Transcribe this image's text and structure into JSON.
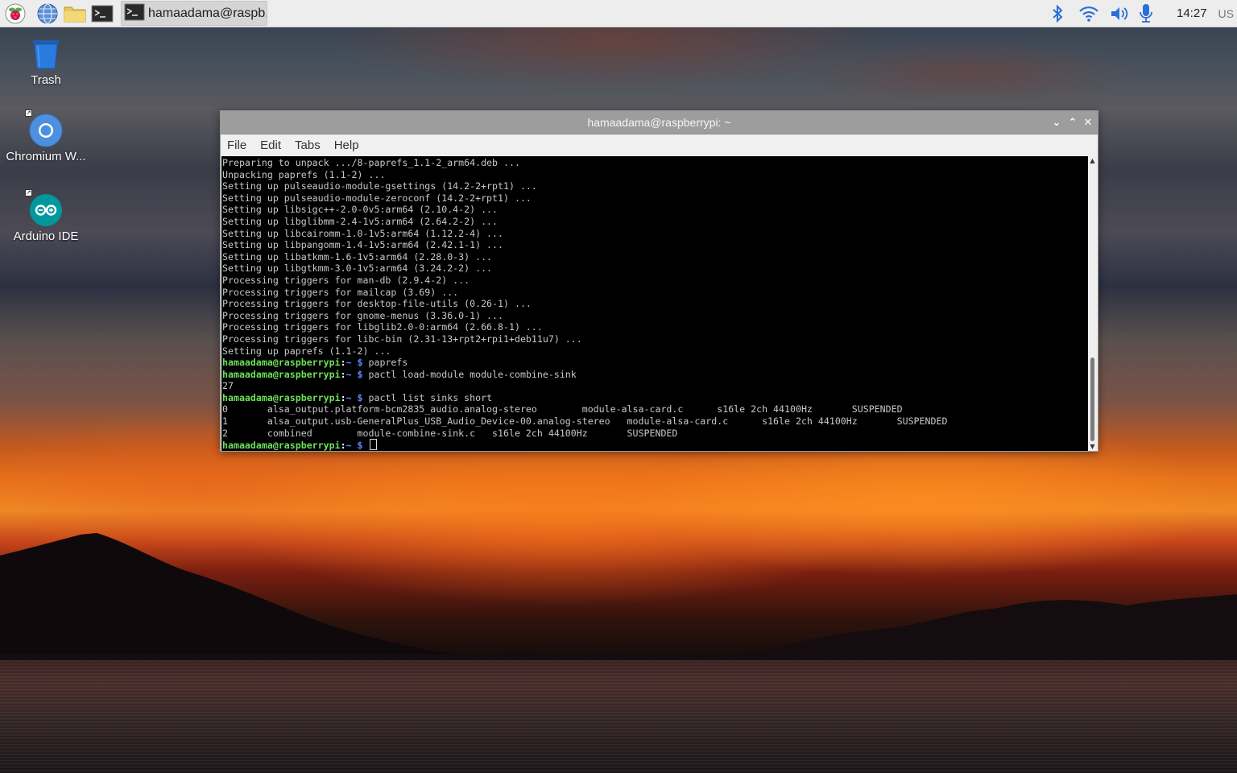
{
  "taskbar": {
    "launchers": [
      {
        "icon": "raspberry-menu-icon"
      },
      {
        "icon": "web-browser-icon"
      },
      {
        "icon": "file-manager-icon"
      },
      {
        "icon": "terminal-icon"
      }
    ],
    "task": {
      "label": "hamaadama@raspb...",
      "icon": "terminal-icon"
    },
    "tray": {
      "icons": [
        "bluetooth-icon",
        "wifi-icon",
        "volume-icon",
        "microphone-icon"
      ],
      "clock": "14:27",
      "keyboard_layout": "US"
    }
  },
  "desktop_icons": [
    {
      "label": "Trash",
      "icon": "trash-icon"
    },
    {
      "label": "Chromium W...",
      "icon": "chromium-icon"
    },
    {
      "label": "Arduino IDE",
      "icon": "arduino-icon"
    }
  ],
  "window": {
    "title": "hamaadama@raspberrypi: ~",
    "menu": [
      "File",
      "Edit",
      "Tabs",
      "Help"
    ],
    "controls": {
      "minimize": "⌄",
      "maximize": "⌃",
      "close": "✕"
    }
  },
  "terminal": {
    "prompt_user": "hamaadama@raspberrypi",
    "prompt_sep": ":",
    "prompt_dir": "~ $",
    "lines": [
      {
        "type": "out",
        "text": "Preparing to unpack .../8-paprefs_1.1-2_arm64.deb ..."
      },
      {
        "type": "out",
        "text": "Unpacking paprefs (1.1-2) ..."
      },
      {
        "type": "out",
        "text": "Setting up pulseaudio-module-gsettings (14.2-2+rpt1) ..."
      },
      {
        "type": "out",
        "text": "Setting up pulseaudio-module-zeroconf (14.2-2+rpt1) ..."
      },
      {
        "type": "out",
        "text": "Setting up libsigc++-2.0-0v5:arm64 (2.10.4-2) ..."
      },
      {
        "type": "out",
        "text": "Setting up libglibmm-2.4-1v5:arm64 (2.64.2-2) ..."
      },
      {
        "type": "out",
        "text": "Setting up libcairomm-1.0-1v5:arm64 (1.12.2-4) ..."
      },
      {
        "type": "out",
        "text": "Setting up libpangomm-1.4-1v5:arm64 (2.42.1-1) ..."
      },
      {
        "type": "out",
        "text": "Setting up libatkmm-1.6-1v5:arm64 (2.28.0-3) ..."
      },
      {
        "type": "out",
        "text": "Setting up libgtkmm-3.0-1v5:arm64 (3.24.2-2) ..."
      },
      {
        "type": "out",
        "text": "Processing triggers for man-db (2.9.4-2) ..."
      },
      {
        "type": "out",
        "text": "Processing triggers for mailcap (3.69) ..."
      },
      {
        "type": "out",
        "text": "Processing triggers for desktop-file-utils (0.26-1) ..."
      },
      {
        "type": "out",
        "text": "Processing triggers for gnome-menus (3.36.0-1) ..."
      },
      {
        "type": "out",
        "text": "Processing triggers for libglib2.0-0:arm64 (2.66.8-1) ..."
      },
      {
        "type": "out",
        "text": "Processing triggers for libc-bin (2.31-13+rpt2+rpi1+deb11u7) ..."
      },
      {
        "type": "out",
        "text": "Setting up paprefs (1.1-2) ..."
      },
      {
        "type": "cmd",
        "text": "paprefs"
      },
      {
        "type": "cmd",
        "text": "pactl load-module module-combine-sink"
      },
      {
        "type": "out",
        "text": "27"
      },
      {
        "type": "cmd",
        "text": "pactl list sinks short"
      },
      {
        "type": "out",
        "text": "0       alsa_output.platform-bcm2835_audio.analog-stereo        module-alsa-card.c      s16le 2ch 44100Hz       SUSPENDED"
      },
      {
        "type": "out",
        "text": "1       alsa_output.usb-GeneralPlus_USB_Audio_Device-00.analog-stereo   module-alsa-card.c      s16le 2ch 44100Hz       SUSPENDED"
      },
      {
        "type": "out",
        "text": "2       combined        module-combine-sink.c   s16le 2ch 44100Hz       SUSPENDED"
      },
      {
        "type": "cmd",
        "text": "",
        "cursor": true
      }
    ]
  }
}
